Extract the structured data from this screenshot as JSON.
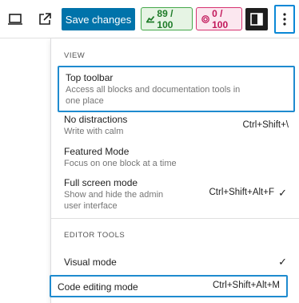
{
  "toolbar": {
    "save_label": "Save changes",
    "performance_score": "89 / 100",
    "seo_score": "0 / 100"
  },
  "menu": {
    "view_label": "VIEW",
    "editor_tools_label": "EDITOR TOOLS",
    "items": [
      {
        "label": "Top toolbar",
        "description": "Access all blocks and documentation tools in one place",
        "shortcut": ""
      },
      {
        "label": "No distractions",
        "description": "Write with calm",
        "shortcut": "Ctrl+Shift+\\"
      },
      {
        "label": "Featured Mode",
        "description": "Focus on one block at a time",
        "shortcut": ""
      },
      {
        "label": "Full screen mode",
        "description": "Show and hide the admin user interface",
        "shortcut": "Ctrl+Shift+Alt+F"
      },
      {
        "label": "Visual mode",
        "description": "",
        "shortcut": ""
      },
      {
        "label": "Code editing mode",
        "description": "",
        "shortcut": "Ctrl+Shift+Alt+M"
      }
    ],
    "check_glyph": "✓"
  },
  "colors": {
    "accent": "#0073aa",
    "focus": "#1f8bcf",
    "performance": "#45a74a",
    "seo": "#d63370"
  }
}
